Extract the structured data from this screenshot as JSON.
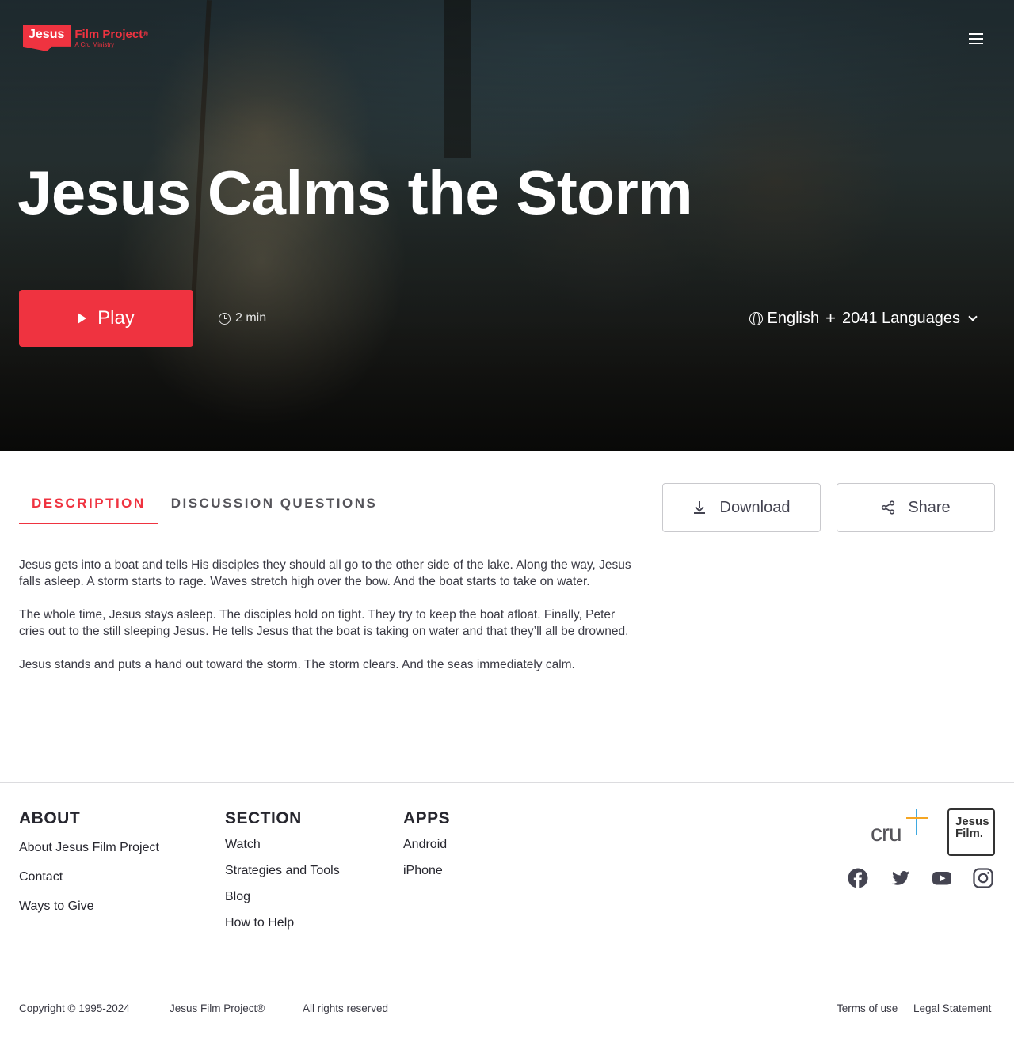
{
  "header": {
    "logo": {
      "mark": "Jesus",
      "title": "Film Project",
      "registered": "®",
      "subtitle": "A Cru Ministry"
    },
    "menu_icon": "hamburger-menu-icon"
  },
  "hero": {
    "title": "Jesus Calms the Storm",
    "play_label": "Play",
    "duration": "2 min",
    "language": "English",
    "language_count": "2041 Languages"
  },
  "tabs": [
    {
      "label": "DESCRIPTION",
      "active": true
    },
    {
      "label": "DISCUSSION QUESTIONS",
      "active": false
    }
  ],
  "actions": {
    "download_label": "Download",
    "share_label": "Share"
  },
  "description": [
    "Jesus gets into a boat and tells His disciples they should all go to the other side of the lake. Along the way, Jesus falls asleep. A storm starts to rage. Waves stretch high over the bow. And the boat starts to take on water.",
    "The whole time, Jesus stays asleep. The disciples hold on tight. They try to keep the boat afloat. Finally, Peter cries out to the still sleeping Jesus. He tells Jesus that the boat is taking on water and that they’ll all be drowned.",
    "Jesus stands and puts a hand out toward the storm. The storm clears. And the seas immediately calm."
  ],
  "footer": {
    "about": {
      "heading": "ABOUT",
      "links": [
        "About Jesus Film Project",
        "Contact",
        "Ways to Give"
      ]
    },
    "section": {
      "heading": "SECTION",
      "links": [
        "Watch",
        "Strategies and Tools",
        "Blog",
        "How to Help"
      ]
    },
    "apps": {
      "heading": "APPS",
      "links": [
        "Android",
        "iPhone"
      ]
    },
    "cru_logo_text": "cru",
    "jf_logo": {
      "line1": "Jesus",
      "line2": "Film."
    },
    "social": [
      "facebook-icon",
      "twitter-icon",
      "youtube-icon",
      "instagram-icon"
    ],
    "copyright": "Copyright © 1995-2024",
    "brand": "Jesus Film Project®",
    "rights": "All rights reserved",
    "terms": "Terms of use",
    "legal": "Legal Statement"
  },
  "colors": {
    "accent": "#ef3340",
    "text": "#26262e"
  }
}
